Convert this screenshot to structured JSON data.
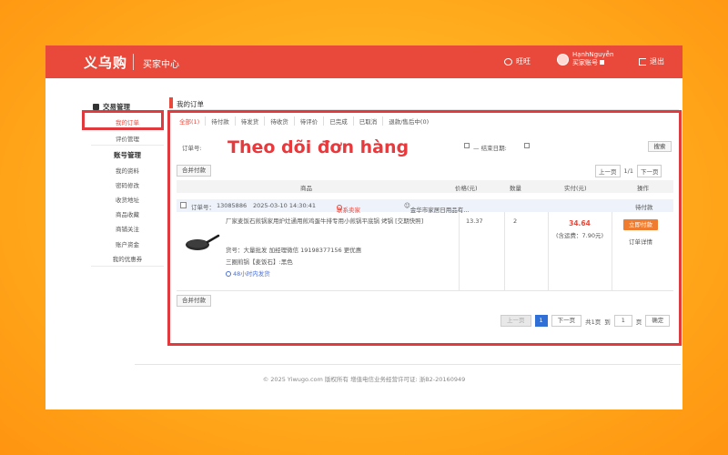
{
  "topbar": {
    "logo": "义乌购",
    "buyer_center": "买家中心",
    "chat_label": "旺旺",
    "username": "HạnhNguyễn",
    "account_label": "买家账号",
    "logout_label": "退出",
    "color": "#e8493a"
  },
  "sidebar": {
    "group1_title": "交易管理",
    "items1": [
      "我的订单",
      "评价管理"
    ],
    "group2_title": "账号管理",
    "items2": [
      "我的资料",
      "密码修改",
      "收货地址",
      "商品收藏",
      "商铺关注",
      "账户资金",
      "我的优惠券"
    ]
  },
  "main": {
    "title": "我的订单",
    "tabs": [
      "全部(1)",
      "待付款",
      "待发货",
      "待收货",
      "待评价",
      "已完成",
      "已取消",
      "退款/售后中(0)"
    ],
    "filters": {
      "order_no_label": "订单号:",
      "end_date_label": "— 结束日期:",
      "search_label": "搜索"
    },
    "merge_pay_label": "合并付款",
    "pager_top": {
      "prev": "上一页",
      "page": "1/1",
      "next": "下一页"
    },
    "table_headers": {
      "product": "商品",
      "price": "价格(元)",
      "quantity": "数量",
      "paid": "实付(元)",
      "actions": "操作"
    },
    "order": {
      "order_no_label": "订单号：",
      "order_no": "13085886",
      "time": "2025-03-10 14:30:41",
      "contact_label": "联系卖家",
      "shop": "金华市家居日用品有...",
      "status": "待付款",
      "product_title": "厂家麦饭石煎锅家用炉灶通用煎鸡蛋牛排专用小煎锅平底锅 烤锅 [交期快照]",
      "product_note": "货号：大量批发 加经理微信 19198377156 更优惠",
      "product_spec": "三圈煎锅【麦饭石】:黑色",
      "shipping": "48小时内发货",
      "price": "13.37",
      "quantity": "2",
      "paid_amount": "34.64",
      "shipping_fee": "(含运费：7.90元)",
      "pay_button": "立即付款",
      "detail_link": "订单详情"
    },
    "pager_bottom": {
      "prev": "上一页",
      "current": "1",
      "next": "下一页",
      "total": "共1页",
      "goto_prefix": "到",
      "goto_value": "1",
      "goto_suffix": "页",
      "confirm": "确定"
    }
  },
  "callout": {
    "text": "Theo dõi đơn hàng",
    "color": "#e8393c"
  },
  "footer": {
    "text": "© 2025 Yiwugo.com 版权所有 增值电信业务经营许可证: 浙B2-20160949"
  }
}
